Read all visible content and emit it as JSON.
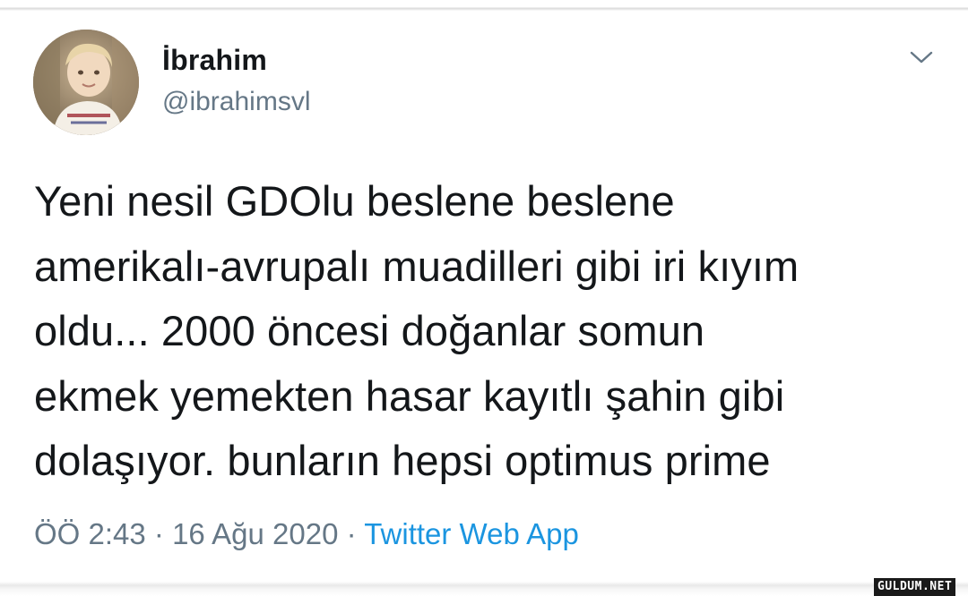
{
  "user": {
    "display_name": "İbrahim",
    "handle": "@ibrahimsvl"
  },
  "tweet": {
    "lines": [
      "Yeni nesil GDOlu beslene beslene",
      "amerikalı-avrupalı muadilleri gibi iri kıyım",
      "oldu... 2000 öncesi doğanlar somun",
      "ekmek yemekten hasar kayıtlı şahin gibi",
      "dolaşıyor. bunların hepsi optimus prime"
    ]
  },
  "meta": {
    "time": "ÖÖ 2:43",
    "separator": "·",
    "date": "16 Ağu 2020",
    "source": "Twitter Web App"
  },
  "icons": {
    "caret": "chevron-down-icon",
    "avatar": "avatar"
  },
  "colors": {
    "text": "#14171a",
    "secondary": "#657786",
    "link": "#1b95e0"
  },
  "watermark": "GULDUM.NET"
}
